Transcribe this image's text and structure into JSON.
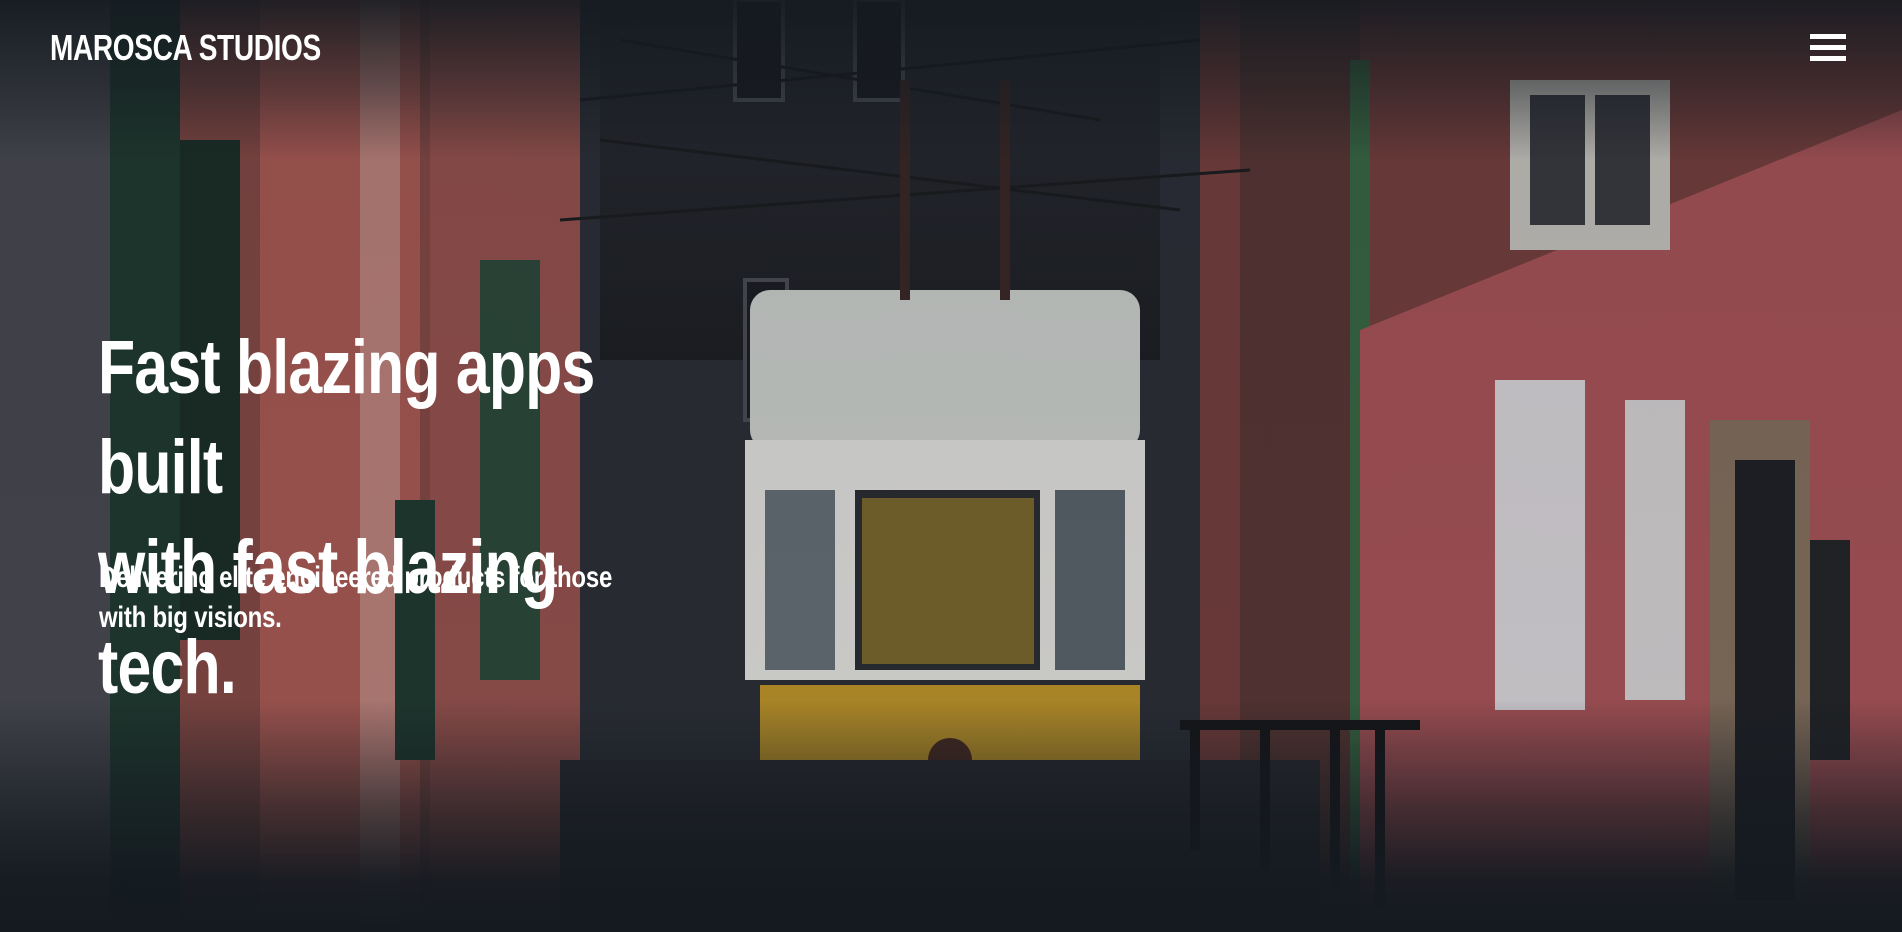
{
  "header": {
    "brand": "MAROSCA STUDIOS",
    "menu_icon": "hamburger-menu-icon"
  },
  "hero": {
    "headline": "Fast blazing apps built\nwith  fast blazing tech.",
    "subheadline": "Delivering elite engineered products for those with big visions.",
    "background": "photo of a yellow tram on a narrow graffiti-covered street"
  },
  "colors": {
    "background": "#141a20",
    "text": "#ffffff",
    "tram_yellow": "#c9a024",
    "wall_pink": "#b86a66"
  }
}
